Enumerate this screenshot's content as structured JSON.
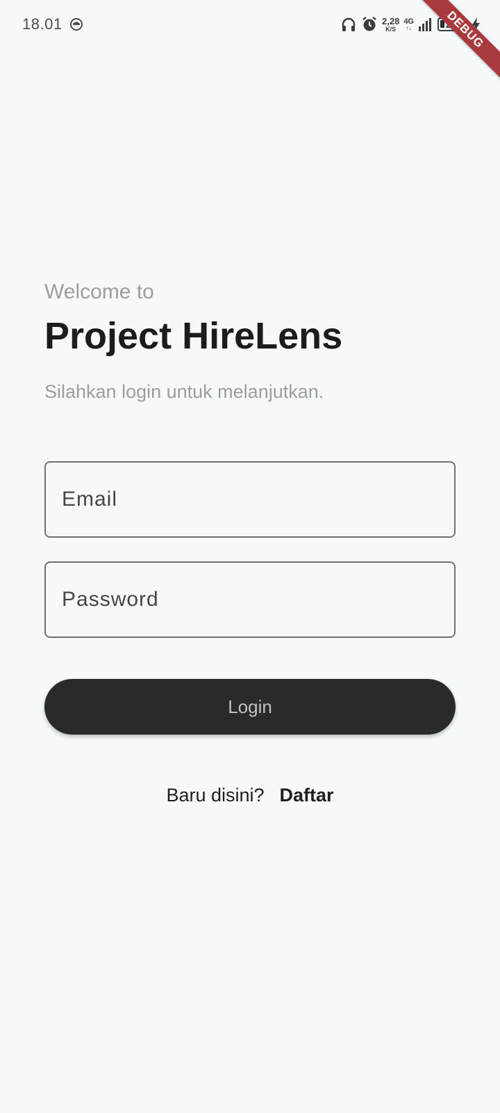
{
  "status_bar": {
    "time": "18.01",
    "speed_value": "2,28",
    "speed_unit": "K/S",
    "network": "4G",
    "network_arrows": "↑↓",
    "battery": "20"
  },
  "debug_banner": "DEBUG",
  "login": {
    "welcome": "Welcome to",
    "title": "Project HireLens",
    "subtitle": "Silahkan login untuk melanjutkan.",
    "email_placeholder": "Email",
    "password_placeholder": "Password",
    "login_label": "Login",
    "signup_prompt": "Baru disini?",
    "signup_link": "Daftar"
  },
  "colors": {
    "background": "#f5f9fa",
    "button": "#2a2a2b",
    "debug": "#a83a3d"
  }
}
